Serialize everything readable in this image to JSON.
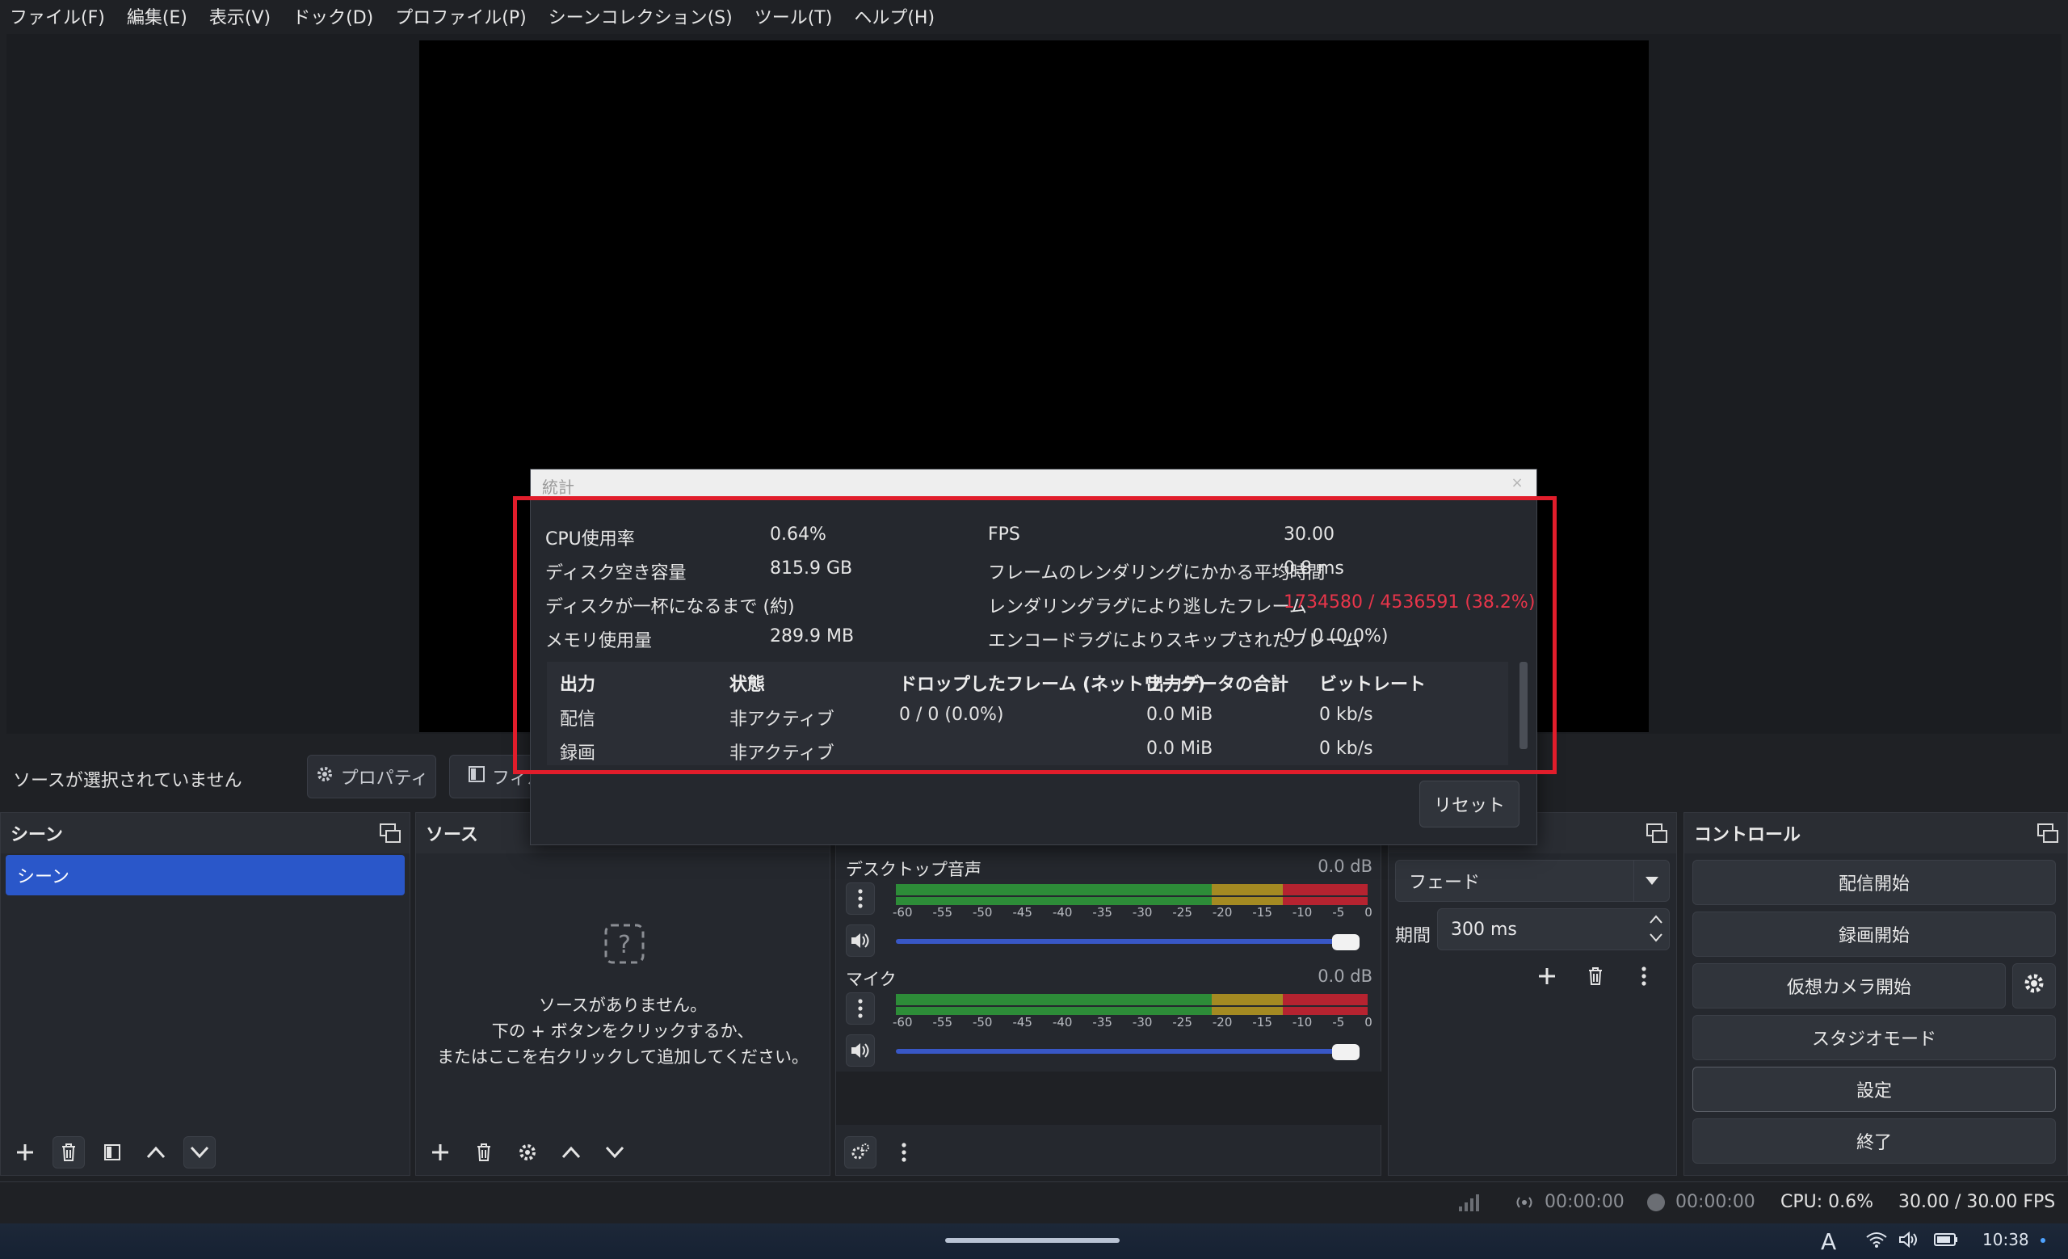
{
  "menu": [
    "ファイル(F)",
    "編集(E)",
    "表示(V)",
    "ドック(D)",
    "プロファイル(P)",
    "シーンコレクション(S)",
    "ツール(T)",
    "ヘルプ(H)"
  ],
  "context_bar": {
    "no_source": "ソースが選択されていません",
    "properties": "プロパティ",
    "filters": "フィル"
  },
  "scenes": {
    "title": "シーン",
    "items": [
      "シーン"
    ]
  },
  "sources": {
    "title": "ソース",
    "empty_line1": "ソースがありません。",
    "empty_line2": "下の + ボタンをクリックするか、",
    "empty_line3": "またはここを右クリックして追加してください。"
  },
  "mixer": {
    "channels": [
      {
        "name": "デスクトップ音声",
        "db": "0.0 dB",
        "volume": 1.0
      },
      {
        "name": "マイク",
        "db": "0.0 dB",
        "volume": 1.0
      }
    ],
    "scale": [
      "-60",
      "-55",
      "-50",
      "-45",
      "-40",
      "-35",
      "-30",
      "-25",
      "-20",
      "-15",
      "-10",
      "-5",
      "0"
    ]
  },
  "transitions": {
    "type": "フェード",
    "duration_label": "期間",
    "duration_value": "300 ms"
  },
  "controls": {
    "title": "コントロール",
    "start_streaming": "配信開始",
    "start_recording": "録画開始",
    "virtual_camera": "仮想カメラ開始",
    "studio_mode": "スタジオモード",
    "settings": "設定",
    "exit": "終了"
  },
  "status": {
    "stream_time": "00:00:00",
    "record_time": "00:00:00",
    "cpu": "CPU: 0.6%",
    "fps": "30.00 / 30.00 FPS"
  },
  "taskbar": {
    "ime": "A",
    "clock": "10:38"
  },
  "stats": {
    "title": "統計",
    "cpu_label": "CPU使用率",
    "cpu_value": "0.64%",
    "disk_label": "ディスク空き容量",
    "disk_value": "815.9 GB",
    "disk_full_label": "ディスクが一杯になるまで (約)",
    "disk_full_value": "",
    "memory_label": "メモリ使用量",
    "memory_value": "289.9 MB",
    "fps_label": "FPS",
    "fps_value": "30.00",
    "render_time_label": "フレームのレンダリングにかかる平均時間",
    "render_time_value": "0.8 ms",
    "render_lag_label": "レンダリングラグにより逃したフレーム",
    "render_lag_value": "1734580 / 4536591 (38.2%)",
    "encode_lag_label": "エンコードラグによりスキップされたフレーム",
    "encode_lag_value": "0 / 0 (0.0%)",
    "table": {
      "headers": [
        "出力",
        "状態",
        "ドロップしたフレーム (ネットワーク)",
        "出力データの合計",
        "ビットレート"
      ],
      "rows": [
        [
          "配信",
          "非アクティブ",
          "0 / 0 (0.0%)",
          "0.0 MiB",
          "0 kb/s"
        ],
        [
          "録画",
          "非アクティブ",
          "",
          "0.0 MiB",
          "0 kb/s"
        ]
      ]
    },
    "reset": "リセット"
  },
  "colors": {
    "accent": "#2a57c9",
    "highlight": "#e11d2b",
    "lag_red": "#e8354a"
  }
}
